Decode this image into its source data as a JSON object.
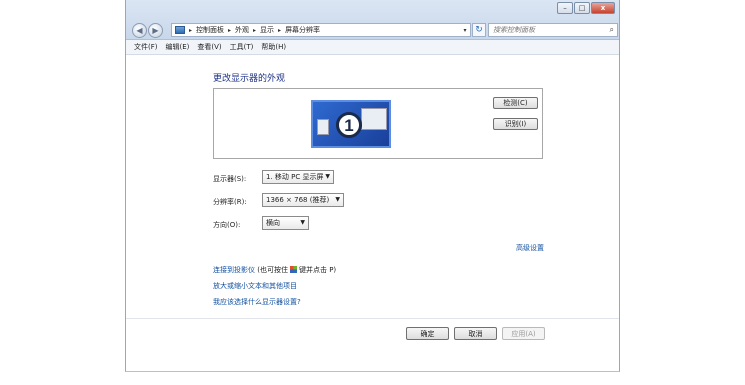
{
  "window": {
    "controls": {
      "minimize": "–",
      "maximize": "□",
      "close": "x"
    }
  },
  "nav": {
    "back": "◀",
    "forward": "▶"
  },
  "address": {
    "crumbs": [
      "控制面板",
      "外观",
      "显示",
      "屏幕分辨率"
    ],
    "separator": "▸",
    "dropdown": "▾",
    "refresh": "↻"
  },
  "search": {
    "placeholder": "搜索控制面板",
    "icon": "search-icon"
  },
  "menu": [
    "文件(F)",
    "编辑(E)",
    "查看(V)",
    "工具(T)",
    "帮助(H)"
  ],
  "page": {
    "title": "更改显示器的外观",
    "monitor_number": "1",
    "detect_label": "检测(C)",
    "identify_label": "识别(I)"
  },
  "fields": {
    "display": {
      "label": "显示器(S):",
      "value": "1. 移动 PC 显示屏"
    },
    "resolution": {
      "label": "分辨率(R):",
      "value": "1366 × 768 (推荐)"
    },
    "orientation": {
      "label": "方向(O):",
      "value": "横向"
    }
  },
  "links": {
    "advanced": "高级设置",
    "projector": "连接到投影仪",
    "projector_hint_pre": "(也可按住",
    "projector_hint_post": "键并点击 P)",
    "text_size": "放大或缩小文本和其他项目",
    "which_settings": "我应该选择什么显示器设置?"
  },
  "footer": {
    "ok": "确定",
    "cancel": "取消",
    "apply": "应用(A)"
  },
  "colors": {
    "link": "#0f4f9f",
    "heading": "#1e3287",
    "monitor_bg": "#2f6ad0"
  }
}
